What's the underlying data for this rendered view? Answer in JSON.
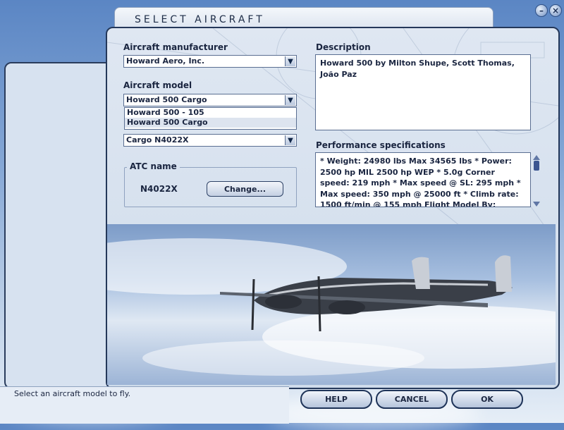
{
  "window": {
    "title": "SELECT AIRCRAFT",
    "minimize_icon": "minimize-icon",
    "close_icon": "close-icon"
  },
  "form": {
    "manufacturer_label": "Aircraft manufacturer",
    "manufacturer_value": "Howard Aero, Inc.",
    "model_label": "Aircraft model",
    "model_value": "Howard 500 Cargo",
    "model_options": [
      "Howard 500 - 105",
      "Howard 500 Cargo"
    ],
    "variation_value": "Cargo N4022X"
  },
  "atc": {
    "label": "ATC name",
    "value": "N4022X",
    "change_label": "Change..."
  },
  "description": {
    "label": "Description",
    "text": "Howard 500 by Milton Shupe, Scott Thomas, João Paz"
  },
  "performance": {
    "label": "Performance specifications",
    "text": "* Weight: 24980 lbs    Max 34565 lbs * Power: 2500 hp MIL  2500 hp WEP * 5.0g Corner speed: 219 mph * Max speed @ SL: 295 mph * Max speed: 350 mph @ 25000 ft * Climb rate: 1500 ft/min @ 155 mph Flight Model By:"
  },
  "status": {
    "text": "Select an aircraft model to fly."
  },
  "buttons": {
    "help": "HELP",
    "cancel": "CANCEL",
    "ok": "OK"
  },
  "colors": {
    "panel_border": "#24385a",
    "accent": "#1a2540"
  }
}
